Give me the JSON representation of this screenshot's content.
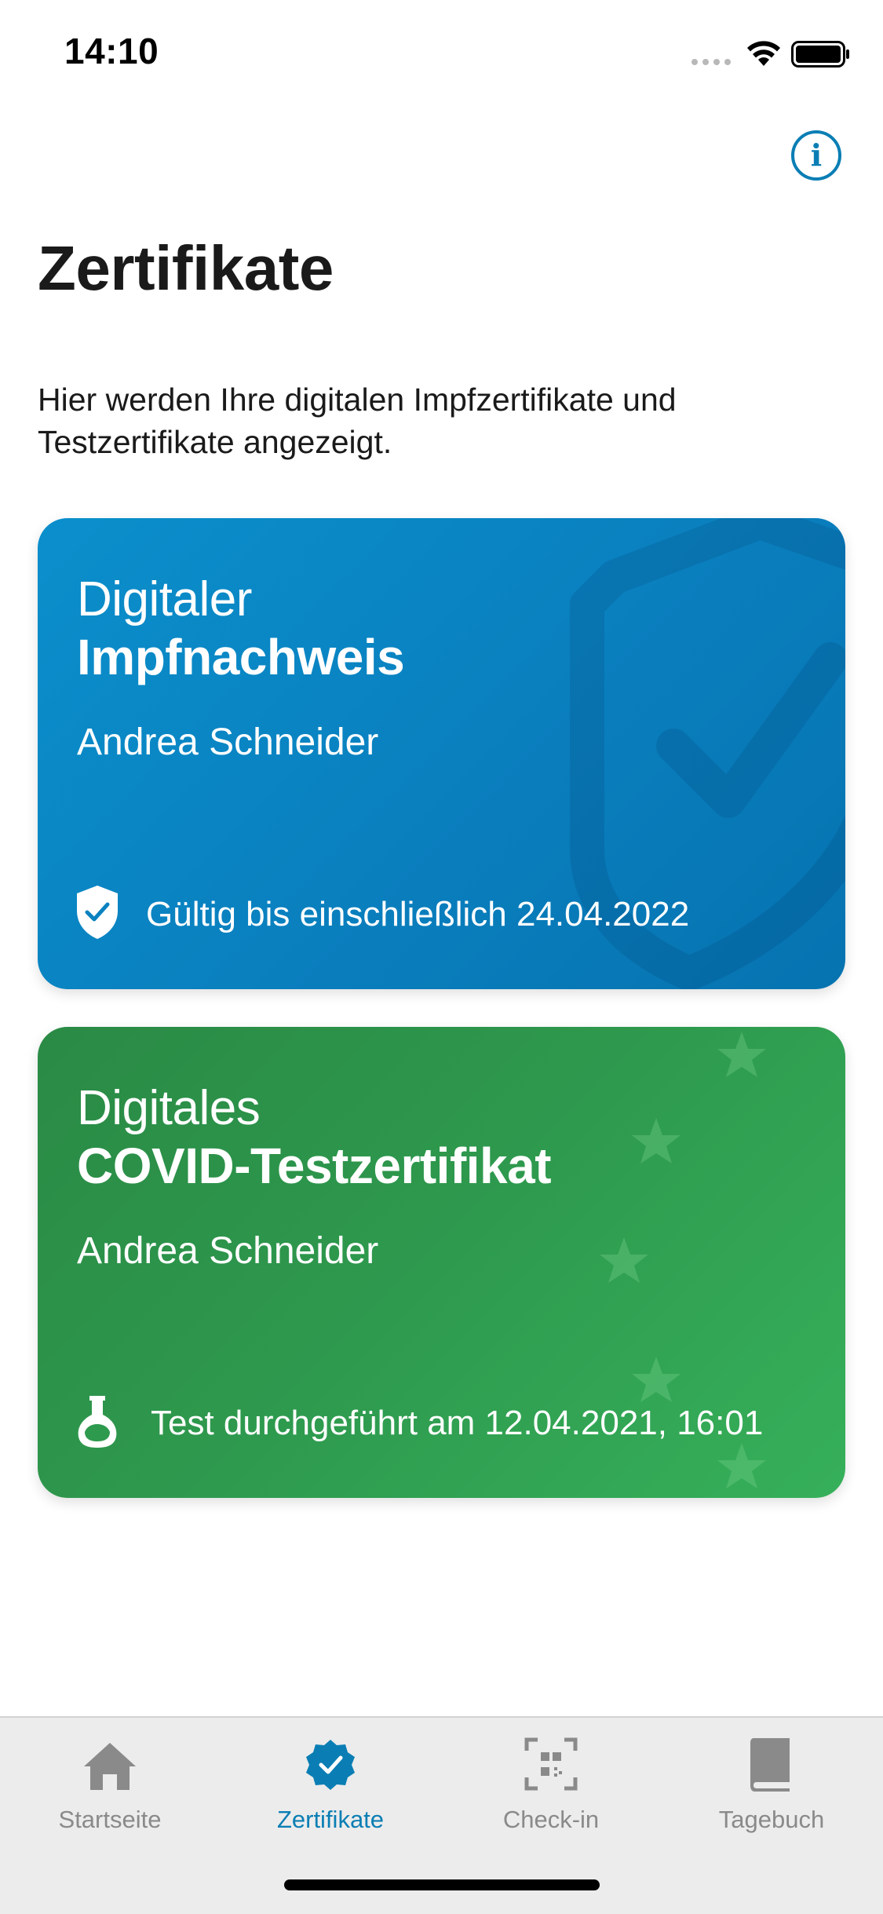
{
  "status_bar": {
    "time": "14:10"
  },
  "header": {
    "title": "Zertifikate",
    "description": "Hier werden Ihre digitalen Impfzertifikate und Testzertifikate angezeigt.",
    "info_icon": "info-circle-icon"
  },
  "cards": [
    {
      "subtitle": "Digitaler",
      "title": "Impfnachweis",
      "name": "Andrea Schneider",
      "status": "Gültig bis einschließlich 24.04.2022",
      "status_icon": "shield-check-icon",
      "color": "#0a86c4"
    },
    {
      "subtitle": "Digitales",
      "title": "COVID-Testzertifikat",
      "name": "Andrea Schneider",
      "status": "Test durchgeführt am 12.04.2021, 16:01",
      "status_icon": "flask-icon",
      "color": "#2e9a4e"
    }
  ],
  "tab_bar": {
    "items": [
      {
        "label": "Startseite",
        "icon": "home-icon",
        "active": false
      },
      {
        "label": "Zertifikate",
        "icon": "certificate-badge-icon",
        "active": true
      },
      {
        "label": "Check-in",
        "icon": "qr-scan-icon",
        "active": false
      },
      {
        "label": "Tagebuch",
        "icon": "book-icon",
        "active": false
      }
    ],
    "active_color": "#0a7eb4",
    "inactive_color": "#8a8a8a"
  }
}
